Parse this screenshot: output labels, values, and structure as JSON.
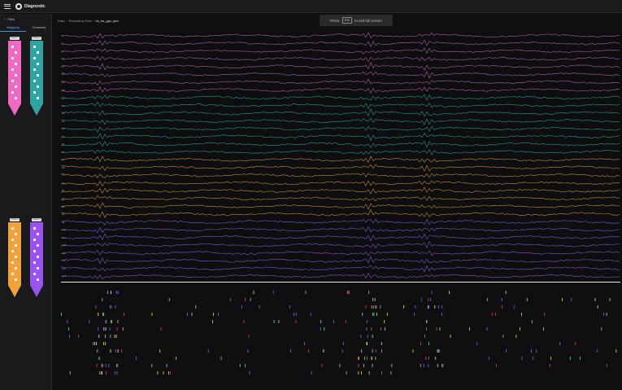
{
  "app": {
    "name": "Diagnostic"
  },
  "sidebar": {
    "back_label": "Files",
    "tabs": [
      {
        "label": "Mapping",
        "active": true
      },
      {
        "label": "Channels",
        "active": false
      }
    ],
    "probes": [
      {
        "label": "Shank 1",
        "color": "#f06ac4"
      },
      {
        "label": "Shank 2",
        "color": "#2fa4a2"
      },
      {
        "label": "Shank 3",
        "color": "#f3a13a"
      },
      {
        "label": "Shank 4",
        "color": "#9a52f0"
      }
    ]
  },
  "breadcrumb": {
    "root": "Data",
    "section": "Recording View",
    "current": "hc_bs_gpc_lpm"
  },
  "fullscreen_hint": {
    "prefix": "Press",
    "key": "F11",
    "suffix": "to exit full screen"
  },
  "traces": {
    "groups": [
      {
        "name": "Shank 1",
        "color": "#d466c8",
        "channels": 8
      },
      {
        "name": "Shank 2",
        "color": "#2fb0a8",
        "channels": 8
      },
      {
        "name": "Shank 3",
        "color": "#e6a23a",
        "channels": 8
      },
      {
        "name": "Shank 4",
        "color": "#9a62f0",
        "channels": 8
      }
    ],
    "channel_labels": [
      "0",
      "4",
      "8",
      "12",
      "16",
      "20",
      "24",
      "28",
      "32",
      "36",
      "40",
      "44",
      "48",
      "52",
      "56",
      "60",
      "64",
      "68",
      "72",
      "76",
      "80",
      "84",
      "88",
      "92",
      "96",
      "100",
      "104",
      "108",
      "112",
      "116",
      "120",
      "124"
    ]
  },
  "raster_colors": [
    "#f6d75a",
    "#6a6aff",
    "#6de09a",
    "#e04a4a",
    "#c9c9c9",
    "#9a62f0"
  ]
}
